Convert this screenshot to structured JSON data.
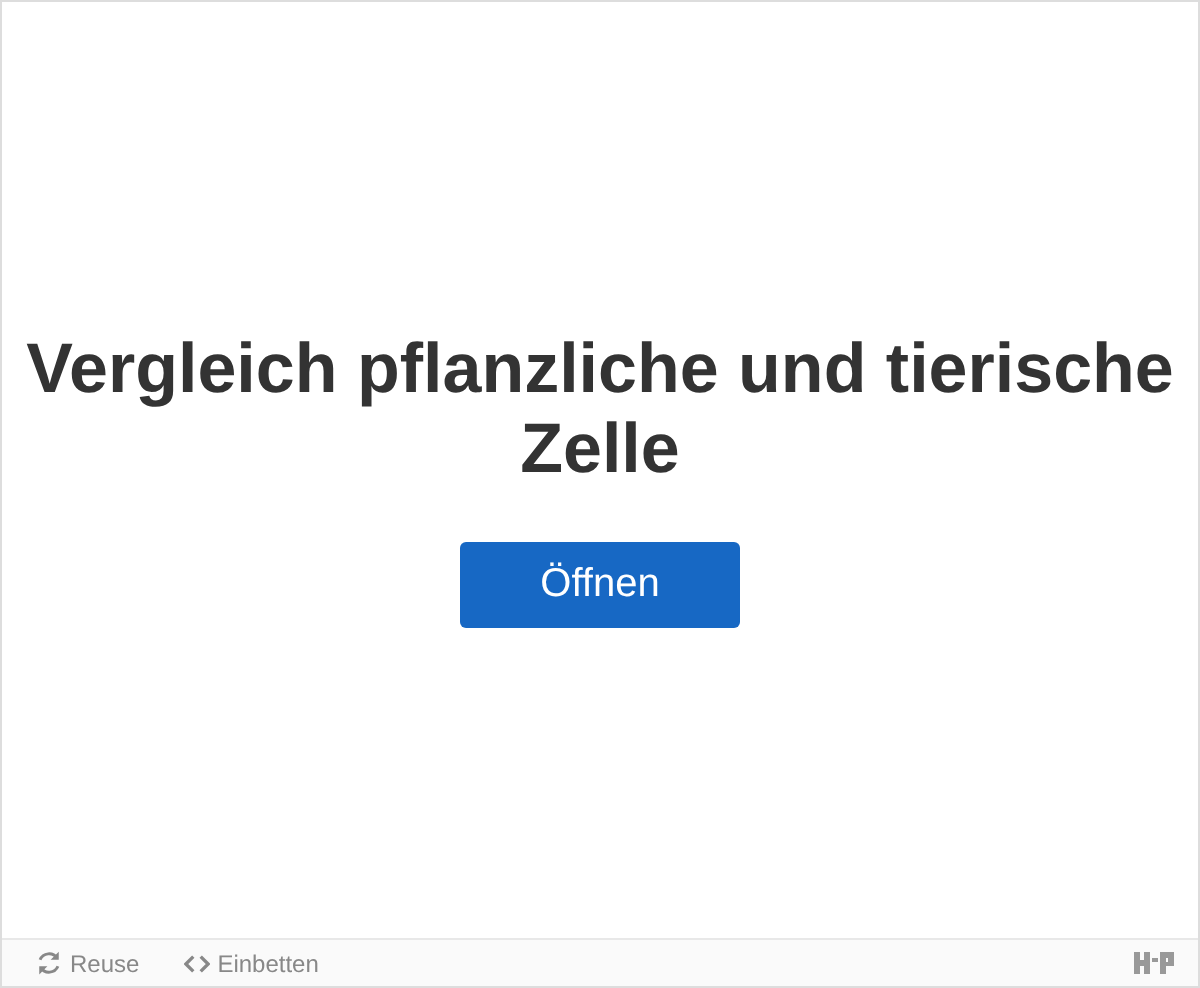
{
  "title": "Vergleich pflanzliche und tierische Zelle",
  "open_button": {
    "label": "Öffnen"
  },
  "footer": {
    "actions": [
      {
        "kind": "reuse",
        "label": "Reuse"
      },
      {
        "kind": "embed",
        "label": "Einbetten"
      }
    ]
  }
}
